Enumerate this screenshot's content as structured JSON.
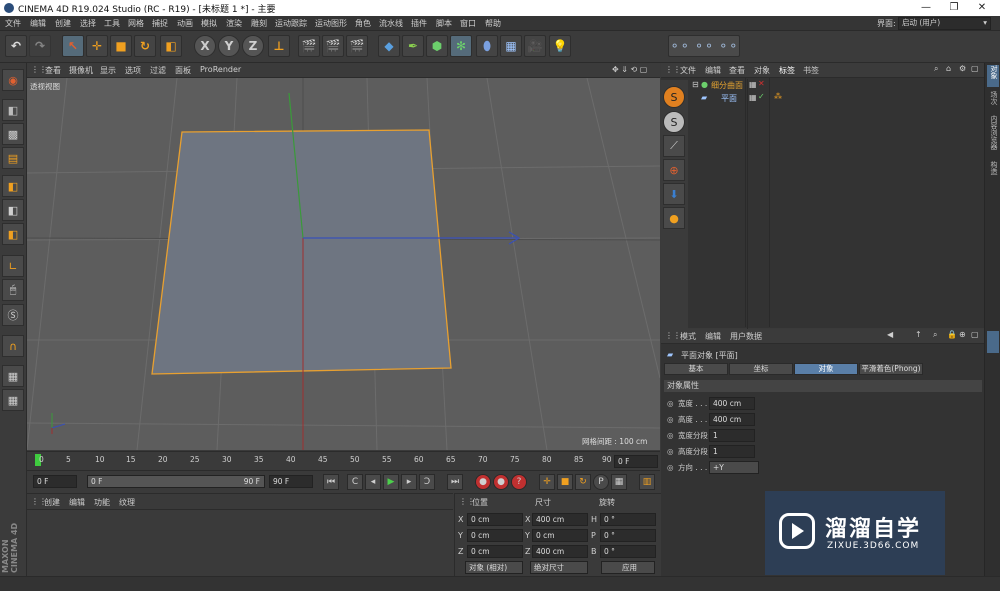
{
  "window": {
    "title": "CINEMA 4D R19.024 Studio (RC - R19) - [未标题 1 *] - 主要",
    "min": "—",
    "max": "❐",
    "close": "✕"
  },
  "menu": [
    "文件",
    "编辑",
    "创建",
    "选择",
    "工具",
    "网格",
    "捕捉",
    "动画",
    "模拟",
    "渲染",
    "雕刻",
    "运动跟踪",
    "运动图形",
    "角色",
    "流水线",
    "插件",
    "脚本",
    "窗口",
    "帮助"
  ],
  "layout": {
    "label": "界面:",
    "value": "启动 (用户)"
  },
  "toolbar": {
    "axis_x": "X",
    "axis_y": "Y",
    "axis_z": "Z"
  },
  "viewport": {
    "menu": [
      "查看",
      "摄像机",
      "显示",
      "选项",
      "过滤",
      "面板",
      "ProRender"
    ],
    "label": "透视视图",
    "grid_info": "网格间距 : 100 cm",
    "nav": "✥ ⇓ ⟲ ▢"
  },
  "timeline": {
    "ticks": [
      "0",
      "5",
      "10",
      "15",
      "20",
      "25",
      "30",
      "35",
      "40",
      "45",
      "50",
      "55",
      "60",
      "65",
      "70",
      "75",
      "80",
      "85",
      "90"
    ],
    "end_field": "0 F"
  },
  "transport": {
    "start": "0 F",
    "cur": "0 F",
    "end": "90 F",
    "max": "90 F"
  },
  "material": {
    "menu": [
      "创建",
      "编辑",
      "功能",
      "纹理"
    ]
  },
  "coords": {
    "headers": [
      "位置",
      "尺寸",
      "旋转"
    ],
    "rows": [
      {
        "a": "X",
        "pos": "0 cm",
        "b": "X",
        "size": "400 cm",
        "c": "H",
        "rot": "0 °"
      },
      {
        "a": "Y",
        "pos": "0 cm",
        "b": "Y",
        "size": "0 cm",
        "c": "P",
        "rot": "0 °"
      },
      {
        "a": "Z",
        "pos": "0 cm",
        "b": "Z",
        "size": "400 cm",
        "c": "B",
        "rot": "0 °"
      }
    ],
    "mode": "对象 (相对)",
    "sizemode": "绝对尺寸",
    "apply": "应用"
  },
  "objects": {
    "menu": [
      "文件",
      "编辑",
      "查看",
      "对象",
      "标签",
      "书签"
    ],
    "items": [
      {
        "name": "细分曲面",
        "color": "#e0a030"
      },
      {
        "name": "平面",
        "color": "#9fc6ff"
      }
    ]
  },
  "attributes": {
    "menu": [
      "模式",
      "编辑",
      "用户数据"
    ],
    "title": "平面对象 [平面]",
    "tabs": [
      "基本",
      "坐标",
      "对象",
      "平滑着色(Phong)"
    ],
    "active_tab": "对象",
    "section": "对象属性",
    "props": [
      {
        "label": "宽度 . . .",
        "value": "400 cm"
      },
      {
        "label": "高度 . . .",
        "value": "400 cm"
      },
      {
        "label": "宽度分段",
        "value": "1"
      },
      {
        "label": "高度分段",
        "value": "1"
      },
      {
        "label": "方向 . . .",
        "value": "+Y"
      }
    ]
  },
  "right_tabs": [
    "对象",
    "场次",
    "内容浏览器",
    "构造"
  ],
  "brand": {
    "maxon": "MAXON",
    "c4d": "CINEMA 4D"
  },
  "watermark": {
    "title": "溜溜自学",
    "url": "ZIXUE.3D66.COM"
  },
  "colors": {
    "accent": "#5a7fa8",
    "selection": "#e8a030"
  }
}
